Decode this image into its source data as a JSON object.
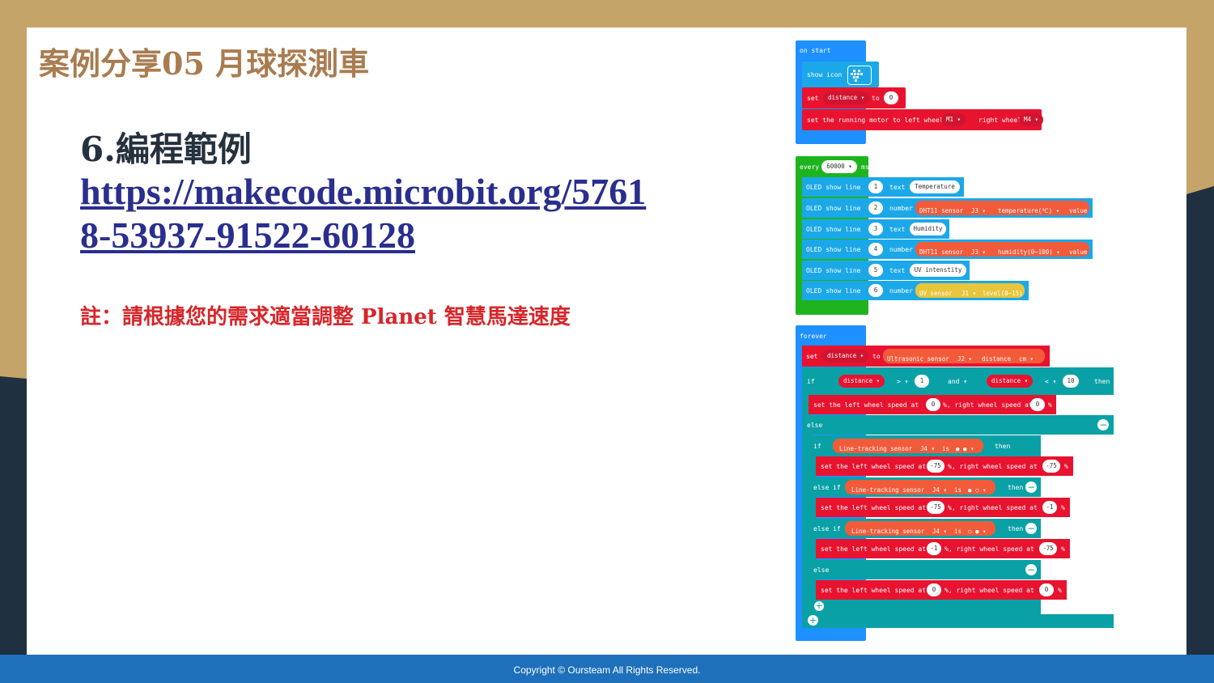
{
  "slide": {
    "title": "案例分享05 月球探測車",
    "heading": "6.編程範例",
    "link": "https://makecode.microbit.org/57618-53937-91522-60128",
    "note": "註：請根據您的需求適當調整  Planet 智慧馬達速度",
    "footer": "Copyright © Oursteam All Rights Reserved."
  },
  "colors": {
    "background_gold": "#c4a468",
    "title_color": "#a97c50",
    "link_color": "#2a2f8d",
    "note_color": "#d7262a",
    "footer_blue": "#1e70ba"
  },
  "code": {
    "on_start": {
      "label": "on start",
      "show_icon": "show icon",
      "set": "set",
      "distance_var": "distance ▾",
      "to": "to",
      "zero": "0",
      "motor_text": "set the running motor to left wheel",
      "m1": "M1 ▾",
      "right_wheel": "right wheel",
      "m4": "M4 ▾"
    },
    "every": {
      "label": "every",
      "interval": "60000 ▾",
      "ms": "ms",
      "oled": "OLED show line",
      "text": "text",
      "number": "number",
      "value": "value",
      "line1": "1",
      "line2": "2",
      "line3": "3",
      "line4": "4",
      "line5": "5",
      "line6": "6",
      "temperature_str": "Temperature",
      "humidity_str": "Humidity",
      "uv_str": "UV intenstity",
      "dht_sensor": "DHT11 sensor",
      "j3": "J3 ▾",
      "temp_opt": "temperature(℃) ▾",
      "hum_opt": "humidity(0~100) ▾",
      "uv_sensor": "UV sensor",
      "j1": "J1 ▾",
      "uv_level": "level(0~15)"
    },
    "forever": {
      "label": "forever",
      "set": "set",
      "distance_var": "distance ▾",
      "to": "to",
      "ultrasonic": "Ultrasonic sensor",
      "j2": "J2 ▾",
      "distance_word": "distance",
      "cm": "cm ▾",
      "if": "if",
      "gt": "> ▾",
      "one": "1",
      "and": "and ▾",
      "lt": "< ▾",
      "ten": "10",
      "then": "then",
      "else": "else",
      "else_if": "else if",
      "speed_left": "set the left wheel speed at",
      "speed_right": "%, right wheel speed at",
      "pct": "%",
      "zero": "0",
      "neg75": "-75",
      "neg1": "-1",
      "line_sensor": "Line-tracking sensor",
      "j4": "J4 ▾",
      "is": "is",
      "state1": "● ● ▾",
      "state2": "● ○ ▾",
      "state3": "○ ● ▾"
    }
  }
}
